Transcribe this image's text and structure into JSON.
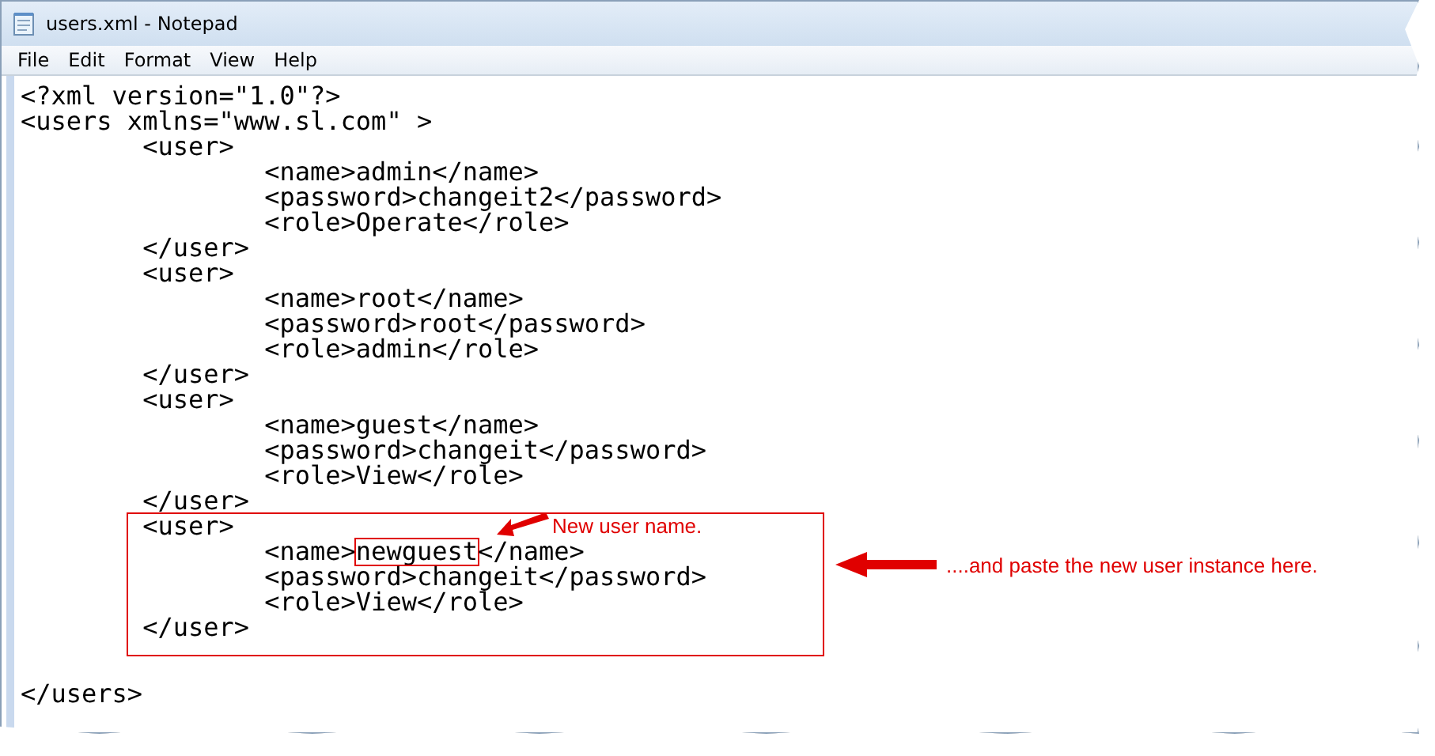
{
  "window": {
    "title": "users.xml - Notepad"
  },
  "menu": [
    "File",
    "Edit",
    "Format",
    "View",
    "Help"
  ],
  "document": {
    "declaration": "<?xml version=\"1.0\"?>",
    "root_open": "<users xmlns=\"www.sl.com\" >",
    "users": [
      {
        "open": "<user>",
        "boxed": false,
        "children": [
          {
            "segments": [
              {
                "text": "<name>admin</name>",
                "boxed": false
              }
            ]
          },
          {
            "segments": [
              {
                "text": "<password>changeit2</password>",
                "boxed": false
              }
            ]
          },
          {
            "segments": [
              {
                "text": "<role>Operate</role>",
                "boxed": false
              }
            ]
          }
        ],
        "close": "</user>"
      },
      {
        "open": "<user>",
        "boxed": false,
        "children": [
          {
            "segments": [
              {
                "text": "<name>root</name>",
                "boxed": false
              }
            ]
          },
          {
            "segments": [
              {
                "text": "<password>root</password>",
                "boxed": false
              }
            ]
          },
          {
            "segments": [
              {
                "text": "<role>admin</role>",
                "boxed": false
              }
            ]
          }
        ],
        "close": "</user>"
      },
      {
        "open": "<user>",
        "boxed": false,
        "children": [
          {
            "segments": [
              {
                "text": "<name>guest</name>",
                "boxed": false
              }
            ]
          },
          {
            "segments": [
              {
                "text": "<password>changeit</password>",
                "boxed": false
              }
            ]
          },
          {
            "segments": [
              {
                "text": "<role>View</role>",
                "boxed": false
              }
            ]
          }
        ],
        "close": "</user>"
      },
      {
        "open": "<user>",
        "boxed": true,
        "children": [
          {
            "segments": [
              {
                "text": "<name>",
                "boxed": false
              },
              {
                "text": "newguest",
                "boxed": true
              },
              {
                "text": "</name>",
                "boxed": false
              }
            ]
          },
          {
            "segments": [
              {
                "text": "<password>changeit</password>",
                "boxed": false
              }
            ]
          },
          {
            "segments": [
              {
                "text": "<role>View</role>",
                "boxed": false
              }
            ]
          }
        ],
        "close": "</user>"
      }
    ],
    "root_close": "</users>"
  },
  "annotations": [
    {
      "text": "New user name.",
      "kind": "diagonal"
    },
    {
      "text": "....and paste the new user instance here.",
      "kind": "horizontal"
    }
  ]
}
